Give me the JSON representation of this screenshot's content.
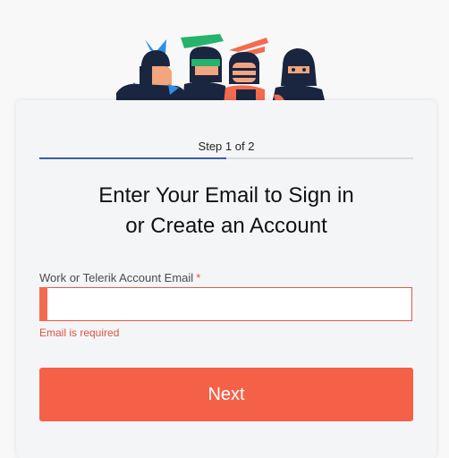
{
  "header": {
    "illustration_icon": "ninja-team-illustration"
  },
  "form": {
    "step_label": "Step 1 of 2",
    "step_progress_fraction": 0.5,
    "title_line1": "Enter Your Email to Sign in",
    "title_line2": "or Create an Account",
    "email_label": "Work or Telerik Account Email",
    "required_marker": "*",
    "email_value": "",
    "error_message": "Email is required",
    "next_label": "Next"
  },
  "colors": {
    "accent": "#f56148",
    "error": "#e0523e",
    "progress": "#3d5aa8"
  }
}
